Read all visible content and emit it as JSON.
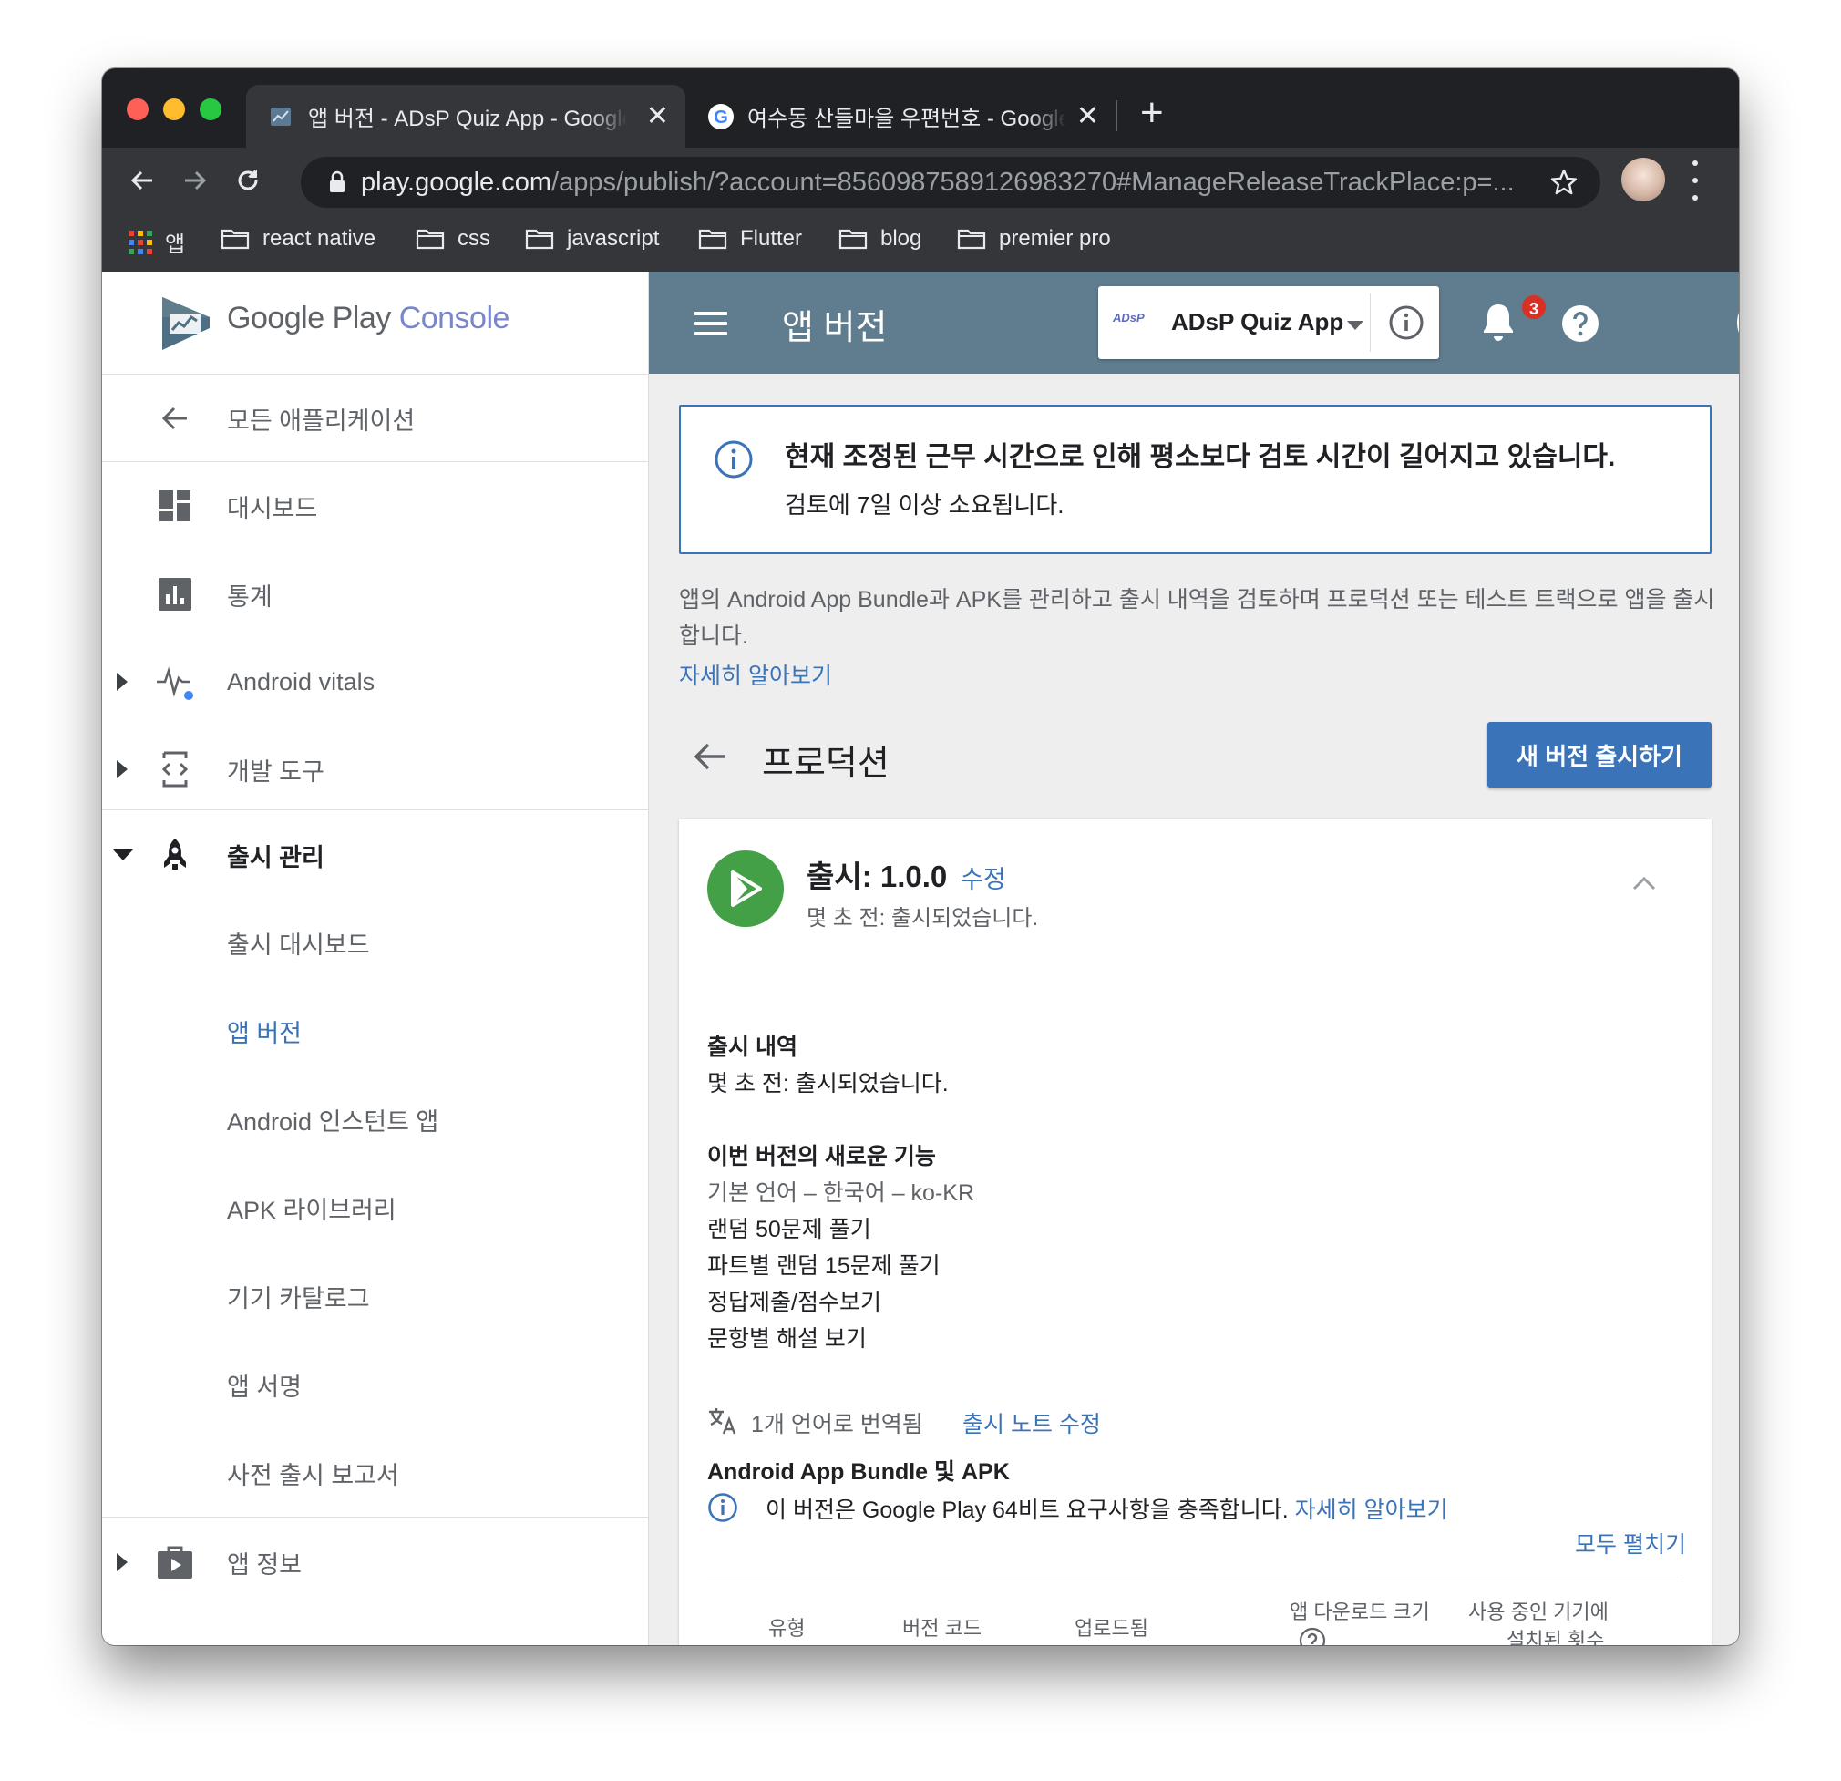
{
  "browser": {
    "tabs": [
      {
        "title": "앱 버전 - ADsP Quiz App - Google Play Console",
        "close": "✕"
      },
      {
        "title": "여수동 산들마을 우편번호 - Google 검색",
        "close": "✕"
      }
    ],
    "new_tab": "+",
    "url_host": "play.google.com",
    "url_path": "/apps/publish/?account=8560987589126983270#ManageReleaseTrackPlace:p=...",
    "bookmarks": [
      "앱",
      "react native",
      "css",
      "javascript",
      "Flutter",
      "blog",
      "premier pro"
    ]
  },
  "sidebar": {
    "logo": {
      "google_play": "Google Play",
      "console": "Console"
    },
    "back_label": "모든 애플리케이션",
    "items": [
      {
        "label": "대시보드"
      },
      {
        "label": "통계"
      },
      {
        "label": "Android vitals"
      },
      {
        "label": "개발 도구"
      },
      {
        "label": "출시 관리"
      }
    ],
    "sub_items": [
      {
        "label": "출시 대시보드"
      },
      {
        "label": "앱 버전"
      },
      {
        "label": "Android 인스턴트 앱"
      },
      {
        "label": "APK 라이브러리"
      },
      {
        "label": "기기 카탈로그"
      },
      {
        "label": "앱 서명"
      },
      {
        "label": "사전 출시 보고서"
      }
    ],
    "app_info_label": "앱 정보"
  },
  "topbar": {
    "title": "앱 버전",
    "app_chip_mini": "ADsP",
    "app_name": "ADsP Quiz App",
    "notification_count": "3"
  },
  "alert": {
    "title": "현재 조정된 근무 시간으로 인해 평소보다 검토 시간이 길어지고 있습니다.",
    "body": "검토에 7일 이상 소요됩니다."
  },
  "intro": {
    "description": "앱의 Android App Bundle과 APK를 관리하고 출시 내역을 검토하며 프로덕션 또는 테스트 트랙으로 앱을 출시합니다.",
    "learn_more": "자세히 알아보기"
  },
  "section": {
    "title": "프로덕션",
    "new_release_button": "새 버전 출시하기"
  },
  "release": {
    "title": "출시: 1.0.0",
    "edit": "수정",
    "subtitle": "몇 초 전: 출시되었습니다.",
    "history_heading": "출시 내역",
    "history_text": "몇 초 전: 출시되었습니다.",
    "whats_new_heading": "이번 버전의 새로운 기능",
    "language_line": "기본 언어 – 한국어 – ko-KR",
    "notes": [
      "랜덤 50문제 풀기",
      "파트별 랜덤 15문제 풀기",
      "정답제출/점수보기",
      "문항별 해설 보기"
    ],
    "translated": "1개 언어로 번역됨",
    "edit_notes": "출시 노트 수정",
    "bundle_heading": "Android App Bundle 및 APK",
    "bundle_info": "이 버전은 Google Play 64비트 요구사항을 충족합니다.",
    "bundle_learn_more": "자세히 알아보기",
    "expand_all": "모두 펼치기",
    "table_headers": {
      "type": "유형",
      "version_code": "버전 코드",
      "uploaded": "업로드됨",
      "download_size": "앱 다운로드 크기",
      "installs_1": "사용 중인 기기에",
      "installs_2": "설치된 횟수"
    }
  },
  "colors": {
    "topbar": "#5f7d8e",
    "accent": "#3b73b9",
    "release_icon": "#43a047",
    "badge": "#d93025"
  }
}
